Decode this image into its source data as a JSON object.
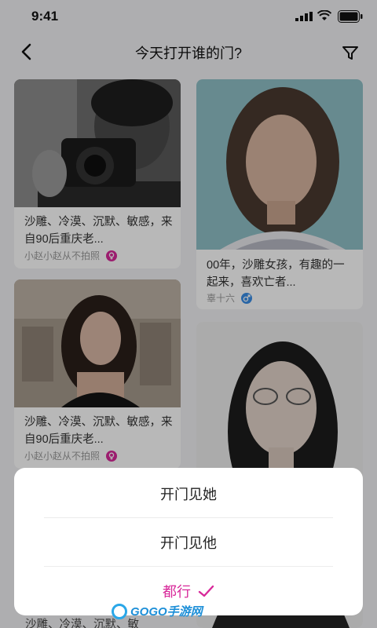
{
  "status_bar": {
    "time": "9:41"
  },
  "nav": {
    "title": "今天打开谁的门?"
  },
  "cards": [
    {
      "desc": "沙雕、冷漠、沉默、敏感，来自90后重庆老...",
      "user": "小赵小赵从不拍照",
      "gender": "female",
      "gender_color": "#d8299a"
    },
    {
      "desc": "00年，沙雕女孩，有趣的一起来，喜欢亡者...",
      "user": "辜十六",
      "gender": "male",
      "gender_color": "#3a8ee6"
    },
    {
      "desc": "沙雕、冷漠、沉默、敏感，来自90后重庆老...",
      "user": "小赵小赵从不拍照",
      "gender": "female",
      "gender_color": "#d8299a"
    }
  ],
  "sheet": {
    "options": [
      {
        "label": "开门见她"
      },
      {
        "label": "开门见他"
      },
      {
        "label": "都行",
        "selected": true
      }
    ],
    "accent": "#d8299a"
  },
  "peek_text": "沙雕、冷漠、沉默、敏",
  "watermark": "GOGO手游网"
}
